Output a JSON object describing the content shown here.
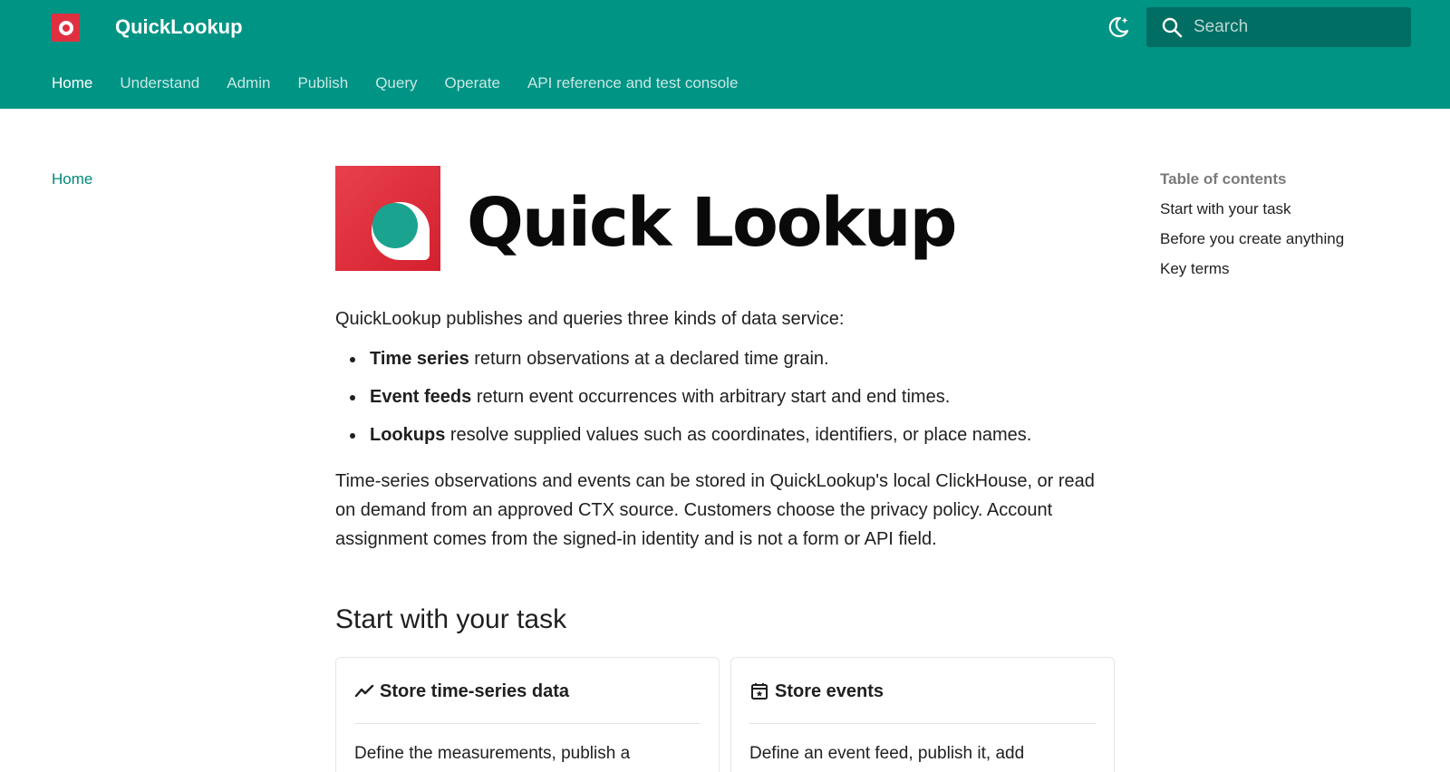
{
  "header": {
    "site_name": "QuickLookup",
    "search_placeholder": "Search",
    "accent": "#009485",
    "brand_red": "#e03040"
  },
  "nav": {
    "items": [
      {
        "label": "Home",
        "active": true
      },
      {
        "label": "Understand"
      },
      {
        "label": "Admin"
      },
      {
        "label": "Publish"
      },
      {
        "label": "Query"
      },
      {
        "label": "Operate"
      },
      {
        "label": "API reference and test console"
      }
    ]
  },
  "sidebar": {
    "home_label": "Home"
  },
  "toc": {
    "title": "Table of contents",
    "items": [
      "Start with your task",
      "Before you create anything",
      "Key terms"
    ]
  },
  "main": {
    "hero_word": "Quick Lookup",
    "intro": "QuickLookup publishes and queries three kinds of data service:",
    "services": [
      {
        "term": "Time series",
        "desc": " return observations at a declared time grain."
      },
      {
        "term": "Event feeds",
        "desc": " return event occurrences with arbitrary start and end times."
      },
      {
        "term": "Lookups",
        "desc": " resolve supplied values such as coordinates, identifiers, or place names."
      }
    ],
    "paragraph": "Time-series observations and events can be stored in QuickLookup's local ClickHouse, or read on demand from an approved CTX source. Customers choose the privacy policy. Account assignment comes from the signed-in identity and is not a form or API field.",
    "section_title": "Start with your task",
    "cards": [
      {
        "icon": "trend-line-icon",
        "title": "Store time-series data",
        "body": "Define the measurements, publish a"
      },
      {
        "icon": "calendar-star-icon",
        "title": "Store events",
        "body": "Define an event feed, publish it, add"
      }
    ]
  }
}
